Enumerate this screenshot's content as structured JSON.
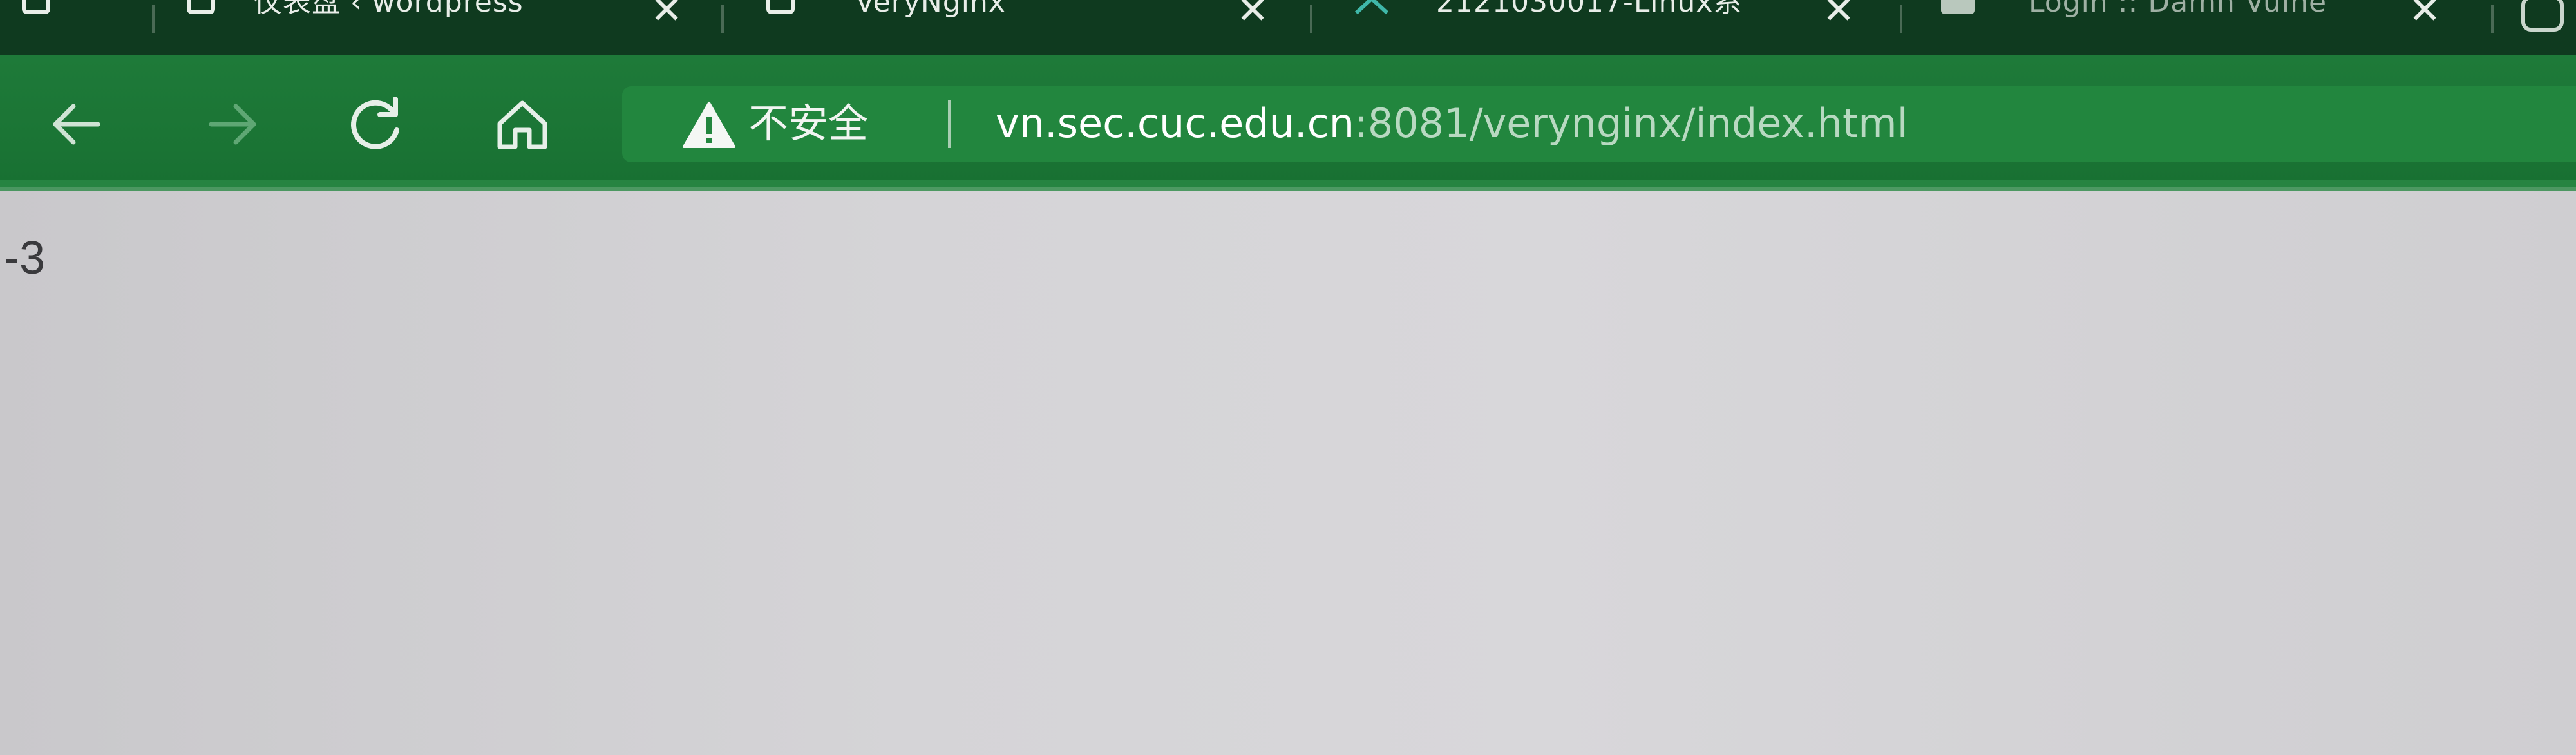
{
  "tabs": [
    {
      "title": "仪表盘 ‹ wordpress",
      "icon": "page-icon",
      "close": "✕"
    },
    {
      "title": "VeryNginx",
      "icon": "page-icon",
      "close": "✕"
    },
    {
      "title": "2121030017-Linux系",
      "icon": "leaf-icon",
      "close": "✕"
    },
    {
      "title": "Login :: Damn Vulne",
      "icon": "doc-icon",
      "close": "✕"
    }
  ],
  "toolbar": {
    "security_label": "不安全",
    "url_host": "vn.sec.cuc.edu.cn",
    "url_rest": ":8081/verynginx/index.html"
  },
  "page": {
    "text": "-3"
  },
  "colors": {
    "tabstrip": "#0f3a1f",
    "toolbar": "#1e7a39",
    "omnibox": "#22863e",
    "page_bg": "#d3d2d5"
  }
}
